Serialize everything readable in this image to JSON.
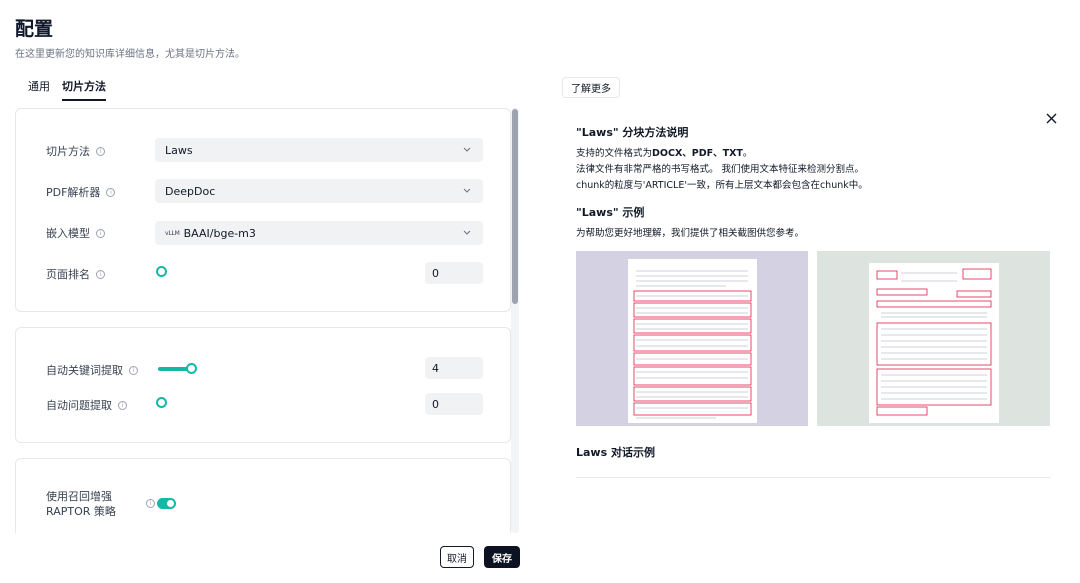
{
  "page": {
    "title": "配置",
    "subtitle": "在这里更新您的知识库详细信息，尤其是切片方法。"
  },
  "tabs": [
    {
      "label": "通用",
      "active": false
    },
    {
      "label": "切片方法",
      "active": true
    }
  ],
  "form": {
    "chunk_method": {
      "label": "切片方法",
      "value": "Laws",
      "icon": "chevron-down-icon"
    },
    "pdf_parser": {
      "label": "PDF解析器",
      "value": "DeepDoc"
    },
    "embedding_model": {
      "label": "嵌入模型",
      "badge": "vLLM",
      "value": "BAAI/bge-m3"
    },
    "page_rank": {
      "label": "页面排名",
      "value": "0",
      "slider_fraction": 0
    },
    "auto_keywords": {
      "label": "自动关键词提取",
      "value": "4",
      "slider_fraction": 0.13
    },
    "auto_questions": {
      "label": "自动问题提取",
      "value": "0",
      "slider_fraction": 0
    },
    "raptor": {
      "label_line1": "使用召回增强",
      "label_line2": "RAPTOR 策略",
      "enabled": true
    }
  },
  "actions": {
    "cancel": "取消",
    "save": "保存"
  },
  "guide": {
    "learn_more": "了解更多",
    "heading": "\"Laws\" 分块方法说明",
    "formats_prefix": "支持的文件格式为",
    "formats": "DOCX、PDF、TXT",
    "formats_suffix": "。",
    "line2": "法律文件有非常严格的书写格式。 我们使用文本特征来检测分割点。",
    "line3": "chunk的粒度与'ARTICLE'一致，所有上层文本都会包含在chunk中。",
    "example_heading": "\"Laws\" 示例",
    "example_desc": "为帮助您更好地理解，我们提供了相关截图供您参考。",
    "dialog_heading": "Laws 对话示例"
  },
  "colors": {
    "accent": "#14b8a6",
    "primary_button": "#0b1221",
    "input_bg": "#f1f2f4",
    "highlight_box": "#e11d48"
  }
}
